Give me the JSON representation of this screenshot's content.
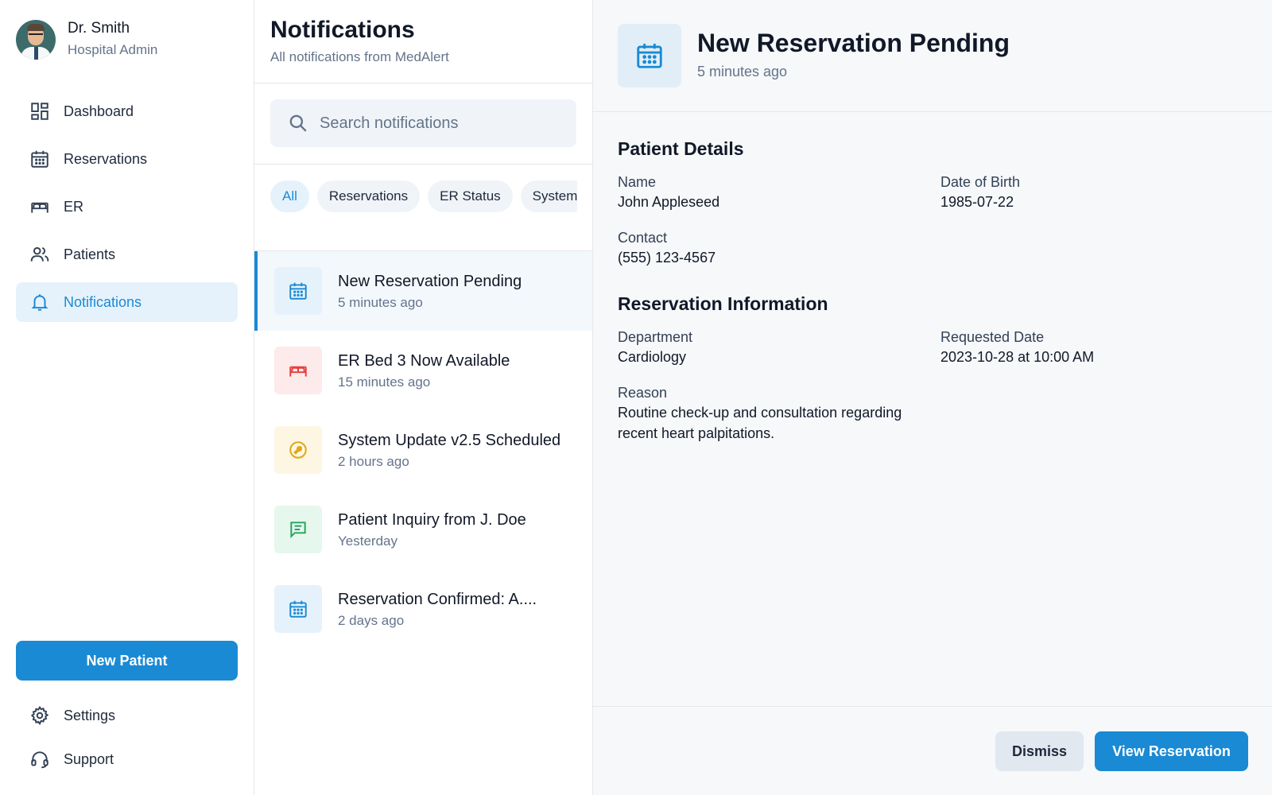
{
  "profile": {
    "name": "Dr. Smith",
    "role": "Hospital Admin"
  },
  "nav": {
    "items": [
      {
        "label": "Dashboard",
        "icon": "dashboard-icon"
      },
      {
        "label": "Reservations",
        "icon": "calendar-icon"
      },
      {
        "label": "ER",
        "icon": "bed-icon"
      },
      {
        "label": "Patients",
        "icon": "users-icon"
      },
      {
        "label": "Notifications",
        "icon": "bell-icon",
        "active": true
      }
    ],
    "new_patient_label": "New Patient",
    "settings_label": "Settings",
    "support_label": "Support"
  },
  "notifications": {
    "title": "Notifications",
    "subtitle": "All notifications from MedAlert",
    "search_placeholder": "Search notifications",
    "filters": [
      "All",
      "Reservations",
      "ER Status",
      "System"
    ],
    "items": [
      {
        "title": "New Reservation Pending",
        "time": "5 minutes ago",
        "icon": "calendar-icon",
        "color": "#1a8ad4"
      },
      {
        "title": "ER Bed 3 Now Available",
        "time": "15 minutes ago",
        "icon": "bed-icon",
        "color": "#e53e3e"
      },
      {
        "title": "System Update v2.5 Scheduled",
        "time": "2 hours ago",
        "icon": "wrench-icon",
        "color": "#e0a81a"
      },
      {
        "title": "Patient Inquiry from J. Doe",
        "time": "Yesterday",
        "icon": "message-icon",
        "color": "#22a55b"
      },
      {
        "title": "Reservation Confirmed: A....",
        "time": "2 days ago",
        "icon": "calendar-icon",
        "color": "#1a8ad4"
      }
    ]
  },
  "detail": {
    "title": "New Reservation Pending",
    "time": "5 minutes ago",
    "patient_section": "Patient Details",
    "name_label": "Name",
    "name_value": "John Appleseed",
    "dob_label": "Date of Birth",
    "dob_value": "1985-07-22",
    "contact_label": "Contact",
    "contact_value": "(555) 123-4567",
    "reservation_section": "Reservation Information",
    "department_label": "Department",
    "department_value": "Cardiology",
    "requested_label": "Requested Date",
    "requested_value": "2023-10-28 at 10:00 AM",
    "reason_label": "Reason",
    "reason_value": "Routine check-up and consultation regarding recent heart palpitations.",
    "dismiss_label": "Dismiss",
    "view_label": "View Reservation"
  },
  "colors": {
    "accent": "#1a8ad4",
    "selected_bg": "#e6f2fb",
    "detail_bg": "#f6f8fa"
  }
}
